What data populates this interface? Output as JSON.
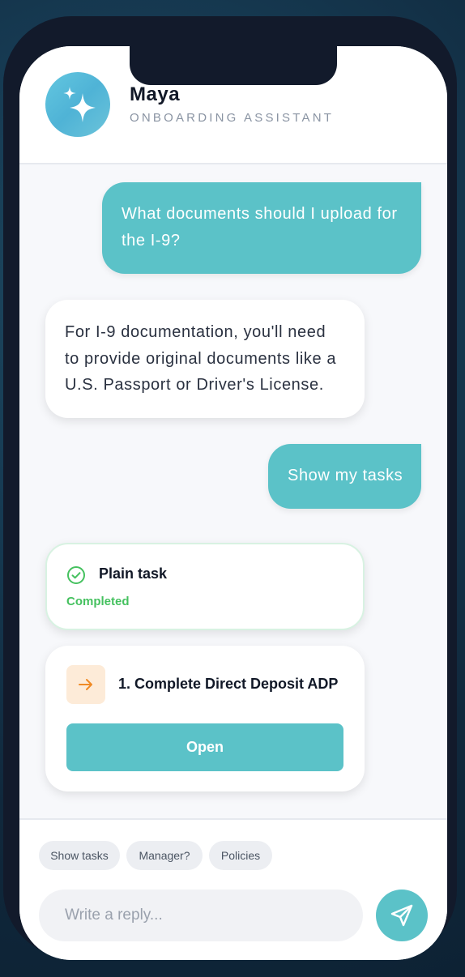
{
  "header": {
    "name": "Maya",
    "role": "ONBOARDING ASSISTANT",
    "avatar_icon": "sparkles-icon"
  },
  "messages": [
    {
      "from": "user",
      "text": "What documents should I upload for the I-9?"
    },
    {
      "from": "assistant",
      "text": "For I-9 documentation, you'll need to provide original documents like a U.S. Passport or Driver's License."
    },
    {
      "from": "user",
      "text": "Show my tasks"
    }
  ],
  "tasks": {
    "completed": {
      "title": "Plain task",
      "status": "Completed",
      "icon": "check-circle-icon",
      "status_color": "#45c15f"
    },
    "pending": {
      "title": "1. Complete Direct Deposit ADP",
      "button_label": "Open",
      "icon": "arrow-right-icon"
    }
  },
  "quick_replies": [
    "Show tasks",
    "Manager?",
    "Policies"
  ],
  "composer": {
    "placeholder": "Write a reply...",
    "value": "",
    "send_icon": "send-icon"
  },
  "colors": {
    "accent": "#5bc2c8",
    "success": "#45c15f",
    "warning_bg": "#fdebd8",
    "warning": "#f08a24"
  }
}
